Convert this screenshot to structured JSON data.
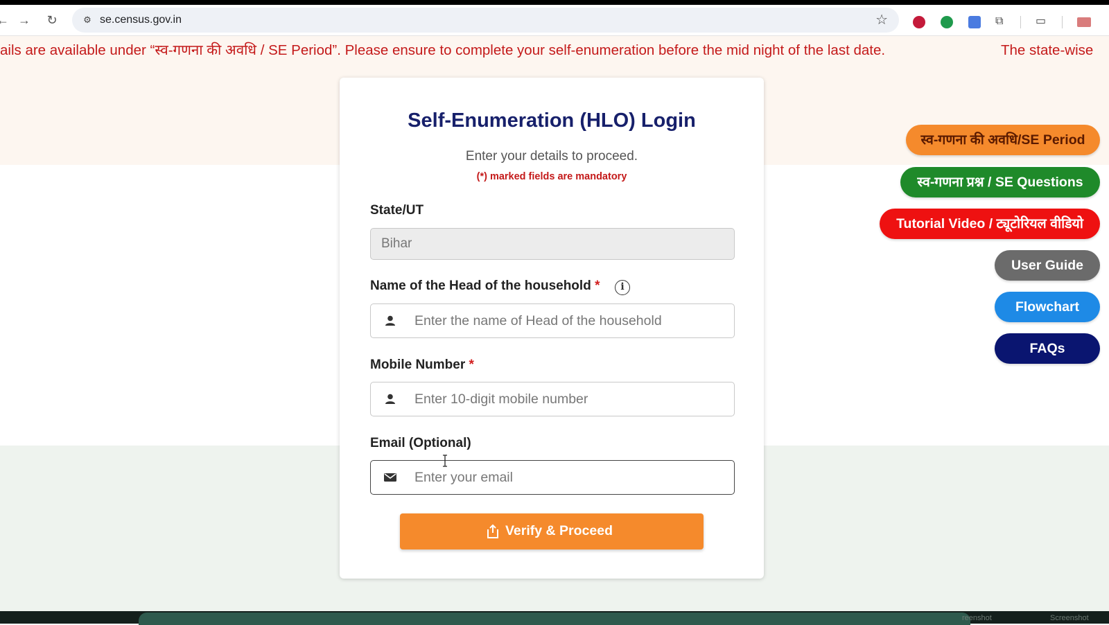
{
  "browser": {
    "url": "se.census.gov.in"
  },
  "ticker": {
    "text_1": "ails are available under “स्व-गणना की अवधि / SE Period”. Please ensure to complete your self-enumeration before the mid night of the last date.",
    "text_2": "The state-wise"
  },
  "login": {
    "title": "Self-Enumeration (HLO) Login",
    "subtitle": "Enter your details to proceed.",
    "mandatory_note": "(*) marked fields are mandatory",
    "state": {
      "label": "State/UT",
      "value": "Bihar"
    },
    "head_name": {
      "label": "Name of the Head of the household",
      "required_mark": "*",
      "placeholder": "Enter the name of Head of the household"
    },
    "mobile": {
      "label": "Mobile Number",
      "required_mark": "*",
      "placeholder": "Enter 10-digit mobile number"
    },
    "email": {
      "label": "Email (Optional)",
      "placeholder": "Enter your email"
    },
    "submit_label": "Verify & Proceed"
  },
  "side_buttons": {
    "se_period": "स्व-गणना की अवधि/SE Period",
    "se_questions": "स्व-गणना प्रश्न / SE Questions",
    "tutorial": "Tutorial Video / ट्यूटोरियल वीडियो",
    "user_guide": "User Guide",
    "flowchart": "Flowchart",
    "faqs": "FAQs"
  },
  "colors": {
    "title": "#17206b",
    "alert_red": "#c41a1a",
    "orange": "#f58a2c",
    "green": "#1f8a2a",
    "red": "#ee1111",
    "gray": "#6b6b6b",
    "blue": "#1e8ae6",
    "navy": "#0a1570"
  },
  "bottom": {
    "label_1": "reenshot",
    "label_2": "Screenshot"
  }
}
